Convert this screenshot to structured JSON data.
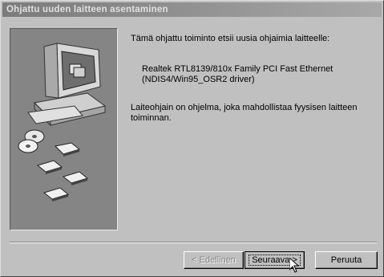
{
  "window": {
    "title": "Ohjattu uuden laitteen asentaminen"
  },
  "content": {
    "intro": "Tämä ohjattu toiminto etsii uusia ohjaimia laitteelle:",
    "device_line1": "Realtek RTL8139/810x Family PCI Fast Ethernet",
    "device_line2": "(NDIS4/Win95_OSR2 driver)",
    "explanation": "Laiteohjain on ohjelma, joka mahdollistaa fyysisen laitteen toiminnan."
  },
  "buttons": {
    "back": "< Edellinen",
    "next": "Seuraava >",
    "cancel": "Peruuta"
  },
  "icons": {
    "art": "computer-with-disks-illustration",
    "cursor": "mouse-pointer-icon"
  },
  "colors": {
    "panel": "#858585",
    "face": "#c0c0c0"
  }
}
